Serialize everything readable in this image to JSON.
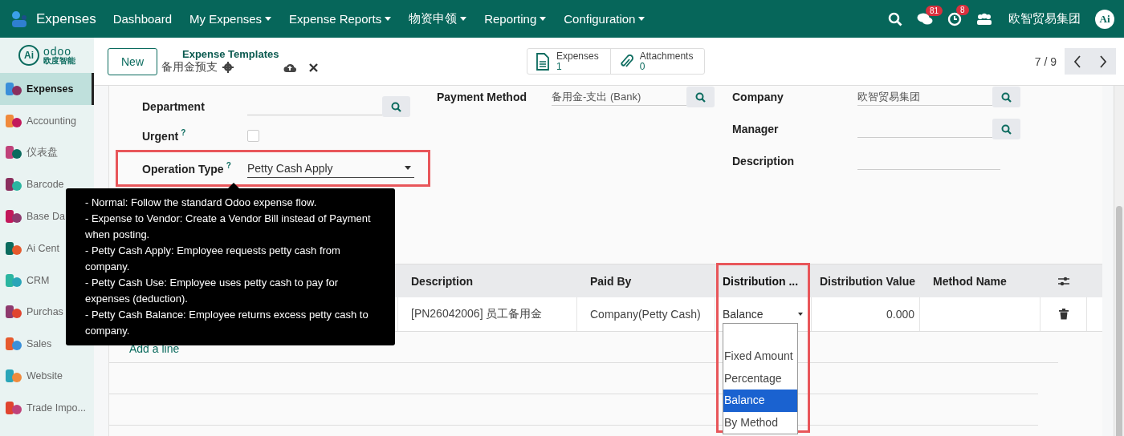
{
  "navbar": {
    "app_name": "Expenses",
    "menu": [
      {
        "label": "Dashboard",
        "dropdown": false
      },
      {
        "label": "My Expenses",
        "dropdown": true
      },
      {
        "label": "Expense Reports",
        "dropdown": true
      },
      {
        "label": "物资申领",
        "dropdown": true
      },
      {
        "label": "Reporting",
        "dropdown": true
      },
      {
        "label": "Configuration",
        "dropdown": true
      }
    ],
    "messages_badge": "81",
    "activities_badge": "8",
    "company": "欧智贸易集团",
    "avatar": "Ai"
  },
  "sidebar": {
    "logo": {
      "mark": "Ai",
      "name": "odoo",
      "subtitle": "欧度智能"
    },
    "items": [
      {
        "label": "Expenses",
        "selected": true
      },
      {
        "label": "Accounting",
        "selected": false
      },
      {
        "label": "仪表盘",
        "selected": false
      },
      {
        "label": "Barcode",
        "selected": false
      },
      {
        "label": "Base Da",
        "selected": false
      },
      {
        "label": "Ai Cent",
        "selected": false
      },
      {
        "label": "CRM",
        "selected": false
      },
      {
        "label": "Purchas",
        "selected": false
      },
      {
        "label": "Sales",
        "selected": false
      },
      {
        "label": "Website",
        "selected": false
      },
      {
        "label": "Trade Impo...",
        "selected": false
      }
    ]
  },
  "control_panel": {
    "new_button": "New",
    "breadcrumb": "Expense Templates",
    "record_name": "备用金预支",
    "smart_buttons": [
      {
        "label": "Expenses",
        "count": "1"
      },
      {
        "label": "Attachments",
        "count": "0"
      }
    ],
    "pager": "7 / 9"
  },
  "form": {
    "middle_fields": [
      {
        "label": "Payment Method",
        "kind": "many2one",
        "value": "备用金-支出 (Bank)",
        "highlighted": false
      }
    ],
    "left_fields": [
      {
        "label": "Department",
        "kind": "many2one",
        "highlighted": false
      },
      {
        "label": "Urgent",
        "kind": "checkbox",
        "checked": false,
        "help": "?",
        "highlighted": false
      },
      {
        "label": "Operation Type",
        "kind": "select",
        "value": "Petty Cash Apply",
        "help": "?",
        "highlighted": true
      }
    ],
    "right_fields": [
      {
        "label": "Company",
        "kind": "many2one",
        "value": "欧智贸易集团",
        "highlighted": false
      },
      {
        "label": "Manager",
        "kind": "many2one",
        "highlighted": false
      },
      {
        "label": "Description",
        "kind": "text",
        "highlighted": false
      }
    ]
  },
  "tooltip": {
    "lines": [
      "- Normal: Follow the standard Odoo expense flow.",
      "- Expense to Vendor: Create a Vendor Bill instead of Payment when posting.",
      "- Petty Cash Apply: Employee requests petty cash from company.",
      "- Petty Cash Use: Employee uses petty cash to pay for expenses (deduction).",
      "- Petty Cash Balance: Employee returns excess petty cash to company."
    ]
  },
  "table": {
    "columns": [
      {
        "label": "Description",
        "highlighted": false
      },
      {
        "label": "Paid By",
        "highlighted": false
      },
      {
        "label": "Distribution ...",
        "highlighted": true
      },
      {
        "label": "Distribution Value",
        "highlighted": false
      },
      {
        "label": "Method Name",
        "highlighted": false
      }
    ],
    "rows": [
      {
        "description": "[PN26042006] 员工备用金",
        "paid_by": "Company(Petty Cash)",
        "distribution": "Balance",
        "distribution_value": "0.000"
      }
    ],
    "add_line": "Add a line"
  },
  "dropdown": {
    "options": [
      {
        "label": "Fixed Amount",
        "selected": false
      },
      {
        "label": "Percentage",
        "selected": false
      },
      {
        "label": "Balance",
        "selected": true
      },
      {
        "label": "By Method",
        "selected": false
      }
    ]
  }
}
